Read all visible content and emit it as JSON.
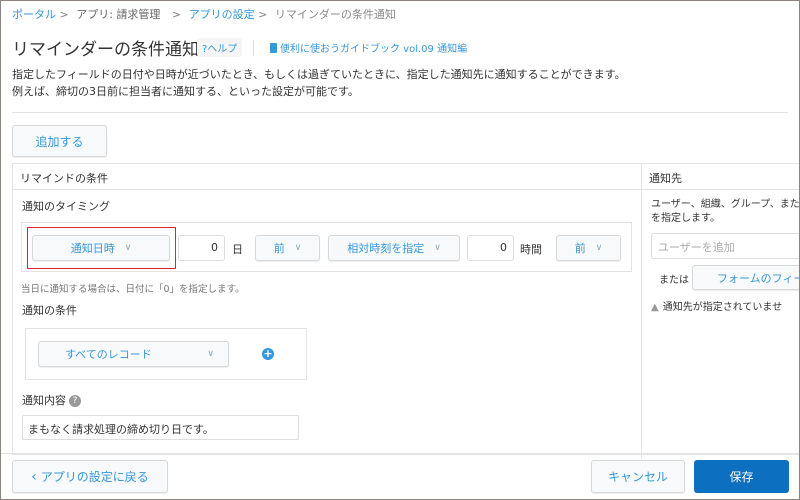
{
  "breadcrumb": {
    "items": [
      "ポータル",
      "アプリ: 請求管理",
      "アプリの設定",
      "リマインダーの条件通知"
    ],
    "separator": ">"
  },
  "header": {
    "title": "リマインダーの条件通知",
    "help": "?ヘルプ",
    "guide": "便利に使おうガイドブック vol.09 通知編"
  },
  "description": [
    "指定したフィールドの日付や日時が近づいたとき、もしくは過ぎていたときに、指定した通知先に通知することができます。",
    "例えば、締切の3日前に担当者に通知する、といった設定が可能です。"
  ],
  "add_button": "追加する",
  "table": {
    "col_conditions": "リマインドの条件",
    "col_recipients": "通知先",
    "timing": {
      "label": "通知のタイミング",
      "field": "通知日時",
      "days": "0",
      "days_unit": "日",
      "days_dir": "前",
      "time_mode": "相対時刻を指定",
      "hours": "0",
      "hours_unit": "時間",
      "hours_dir": "前",
      "note": "当日に通知する場合は、日付に「0」を指定します。"
    },
    "condition": {
      "label": "通知の条件",
      "value": "すべてのレコード"
    },
    "content": {
      "label": "通知内容",
      "value": "まもなく請求処理の締め切り日です。"
    },
    "recipients": {
      "desc_1": "ユーザー、組織、グループ、または",
      "desc_2": "を指定します。",
      "user_placeholder": "ユーザーを追加",
      "or": "または",
      "form_field": "フォームのフィー",
      "warning": "通知先が指定されていませ"
    }
  },
  "footer": {
    "back": "アプリの設定に戻る",
    "cancel": "キャンセル",
    "save": "保存"
  },
  "colors": {
    "accent": "#3498db",
    "primary": "#0d6fbf",
    "highlight": "#e0242a"
  }
}
